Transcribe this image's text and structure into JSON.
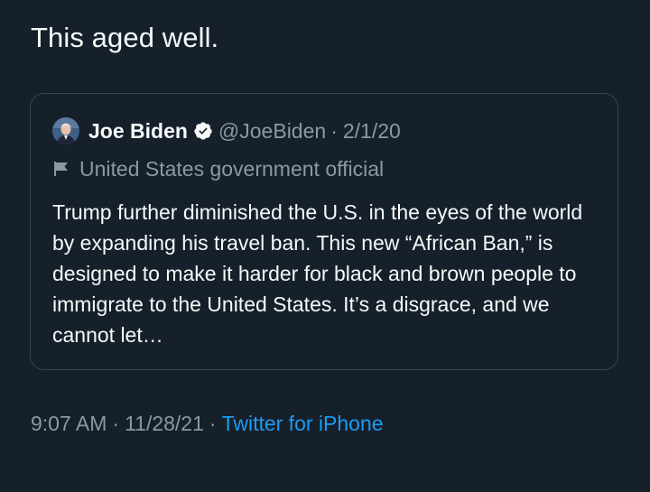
{
  "tweet": {
    "text": "This aged well."
  },
  "quote": {
    "author_name": "Joe Biden",
    "handle": "@JoeBiden",
    "separator": "·",
    "date": "2/1/20",
    "label": "United States government official",
    "body": "Trump further diminished the U.S. in the eyes of the world by expanding his travel ban. This new “African Ban,” is designed to make it harder for black and brown people to immigrate to the United States. It’s a disgrace, and we cannot let…",
    "icons": {
      "avatar": "avatar",
      "verified": "verified-badge-icon",
      "label": "flag-icon"
    }
  },
  "meta": {
    "time": "9:07 AM",
    "separator1": "·",
    "date": "11/28/21",
    "separator2": "·",
    "source": "Twitter for iPhone"
  },
  "colors": {
    "background": "#15202b",
    "text": "#f7f9f9",
    "secondary": "#8b98a5",
    "border": "#38444d",
    "accent": "#1d9bf0"
  }
}
